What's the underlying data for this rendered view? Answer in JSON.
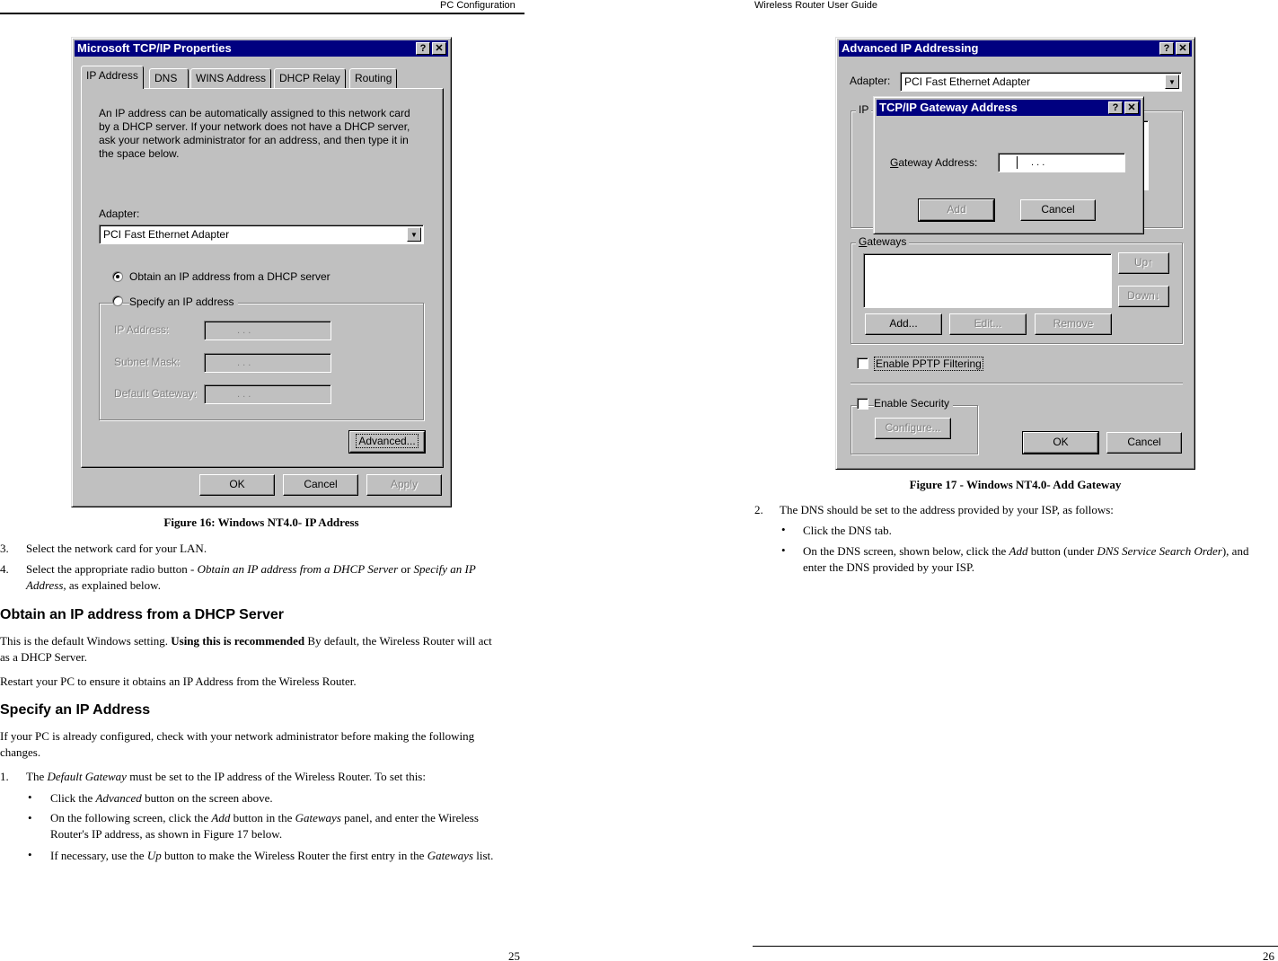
{
  "left_page": {
    "header": "PC Configuration",
    "page_number": "25",
    "figure": {
      "caption": "Figure 16: Windows NT4.0- IP Address",
      "dialog": {
        "title": "Microsoft TCP/IP Properties",
        "help_btn": "?",
        "close_btn": "✕",
        "tabs": [
          "IP Address",
          "DNS",
          "WINS Address",
          "DHCP Relay",
          "Routing"
        ],
        "active_tab": "IP Address",
        "intro_lines": [
          "An IP address can be automatically assigned to this network card",
          "by a DHCP server.  If your network does not have a DHCP server,",
          "ask your network administrator for an address, and then type it in",
          "the space below."
        ],
        "adapter_label": "Adapter:",
        "adapter_value": "PCI Fast Ethernet Adapter",
        "combo_arrow": "▼",
        "radio_dhcp": "Obtain an IP address from a DHCP server",
        "radio_dhcp_selected": true,
        "radio_specify": "Specify an IP address",
        "ip_label": "IP Address:",
        "subnet_label": "Subnet Mask:",
        "gateway_label": "Default Gateway:",
        "ip_dots": ".          .          .",
        "advanced_btn": "Advanced...",
        "ok_btn": "OK",
        "cancel_btn": "Cancel",
        "apply_btn": "Apply"
      }
    },
    "steps_a": [
      {
        "num": "3.",
        "text": "Select the network card for your LAN."
      },
      {
        "num": "4.",
        "text_prefix": "Select the appropriate radio button - ",
        "em1": "Obtain an IP address from a DHCP Server",
        "mid": " or ",
        "em2": "Specify an IP Address",
        "suffix": ", as explained below."
      }
    ],
    "section1": {
      "heading": "Obtain an IP address from a DHCP Server",
      "para1_a": "This is the default Windows setting. ",
      "para1_bold": "Using this is recommended",
      "para1_b": " By default, the Wireless Router will act as a DHCP Server.",
      "para2": "Restart your PC to ensure it obtains an IP Address from the Wireless Router."
    },
    "section2": {
      "heading": "Specify an IP Address",
      "para1": "If your PC is already configured, check with your network administrator before making the following changes.",
      "step1_num": "1.",
      "step1_pre": "The ",
      "step1_em": "Default Gateway",
      "step1_post": " must be set to the IP address of the Wireless Router. To set this:",
      "bullets": [
        {
          "pre": "Click the ",
          "em": "Advanced",
          "post": " button on the screen above."
        },
        {
          "pre": "On the following screen, click the ",
          "em": "Add",
          "mid": " button in the ",
          "em2": "Gateways",
          "post": " panel, and enter the Wireless Router's IP address, as shown in Figure 17 below."
        },
        {
          "pre": "If necessary, use the ",
          "em": "Up",
          "mid": " button to make the Wireless Router the first entry in the ",
          "em2": "Gateways",
          "post": " list."
        }
      ],
      "bullet_glyph": "•"
    }
  },
  "right_page": {
    "header": "Wireless Router User Guide",
    "page_number": "26",
    "figure": {
      "caption": "Figure 17 - Windows NT4.0- Add Gateway",
      "dialog": {
        "title": "Advanced IP Addressing",
        "help_btn": "?",
        "close_btn": "✕",
        "adapter_label": "Adapter:",
        "adapter_value": "PCI Fast Ethernet Adapter",
        "combo_arrow": "▼",
        "ip_group_label": "IP",
        "gateways_label": "Gateways",
        "up_btn": "Up↑",
        "down_btn": "Down↓",
        "add_btn": "Add...",
        "edit_btn": "Edit...",
        "remove_btn": "Remove",
        "pptp_label": "Enable PPTP Filtering",
        "pptp_checked": false,
        "security_label": "Enable Security",
        "security_checked": false,
        "configure_btn": "Configure...",
        "ok_btn": "OK",
        "cancel_btn": "Cancel"
      },
      "subdialog": {
        "title": "TCP/IP Gateway Address",
        "help_btn": "?",
        "close_btn": "✕",
        "gateway_label": "Gateway Address:",
        "gateway_dots": ".          .          .",
        "add_btn": "Add",
        "cancel_btn": "Cancel"
      }
    },
    "step2": {
      "num": "2.",
      "text": "The DNS should be set to the address provided by your ISP, as follows:",
      "bullets": [
        {
          "pre": "Click the DNS tab."
        },
        {
          "pre": "On the DNS screen, shown below, click the ",
          "em": "Add",
          "mid": " button (under ",
          "em2": "DNS Service Search Order",
          "post": "), and enter the DNS provided by your ISP."
        }
      ],
      "bullet_glyph": "•"
    }
  }
}
